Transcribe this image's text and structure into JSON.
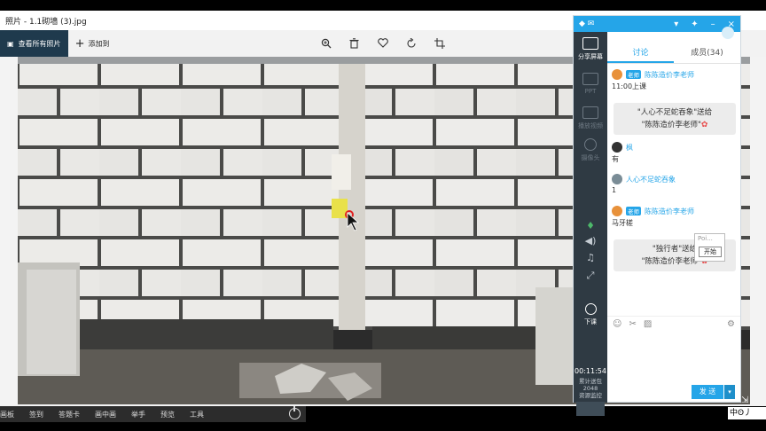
{
  "photos_app": {
    "title": "照片 - 1.1砌墙 (3).jpg",
    "view_all_label": "查看所有照片",
    "add_label": "添加到",
    "tools": [
      {
        "icon": "zoom-icon"
      },
      {
        "icon": "delete-icon"
      },
      {
        "icon": "favorite-icon"
      },
      {
        "icon": "rotate-icon"
      },
      {
        "icon": "crop-icon"
      }
    ]
  },
  "taskbar": {
    "items": [
      "画板",
      "签到",
      "答题卡",
      "画中画",
      "举手",
      "预览",
      "工具"
    ]
  },
  "panel": {
    "sidebar": {
      "share_screen": "分享屏幕",
      "ppt": "PPT",
      "play_media": "播放视频",
      "camera": "摄像头",
      "end_class": "下课",
      "timer": "00:11:54",
      "stat_label": "累计送包",
      "stat_value": "2048",
      "resource": "资源监控"
    },
    "tabs": {
      "discussion": "讨论",
      "members": "成员(34)"
    },
    "messages": [
      {
        "badge": "老师",
        "name": "陈陈造价李老师",
        "text": "11:00上课"
      },
      {
        "name": "枫",
        "text": "有"
      },
      {
        "name": "人心不足蛇吞象",
        "text": "1"
      },
      {
        "badge": "老师",
        "name": "陈陈造价李老师",
        "text": "马牙槎"
      }
    ],
    "gifts": [
      {
        "line1": "\"人心不足蛇吞象\"送给",
        "line2": "\"陈陈造价李老师\""
      },
      {
        "line1": "\"独行者\"送给",
        "line2": "\"陈陈造价李老师\""
      }
    ],
    "popup": {
      "title": "Poi...",
      "button": "开始"
    },
    "send_label": "发 送"
  },
  "ime": {
    "text": "中ʘ丿"
  },
  "colors": {
    "accent": "#25a5e8",
    "sidebar": "#2f3a43",
    "teacher_badge": "#25a5e8"
  }
}
